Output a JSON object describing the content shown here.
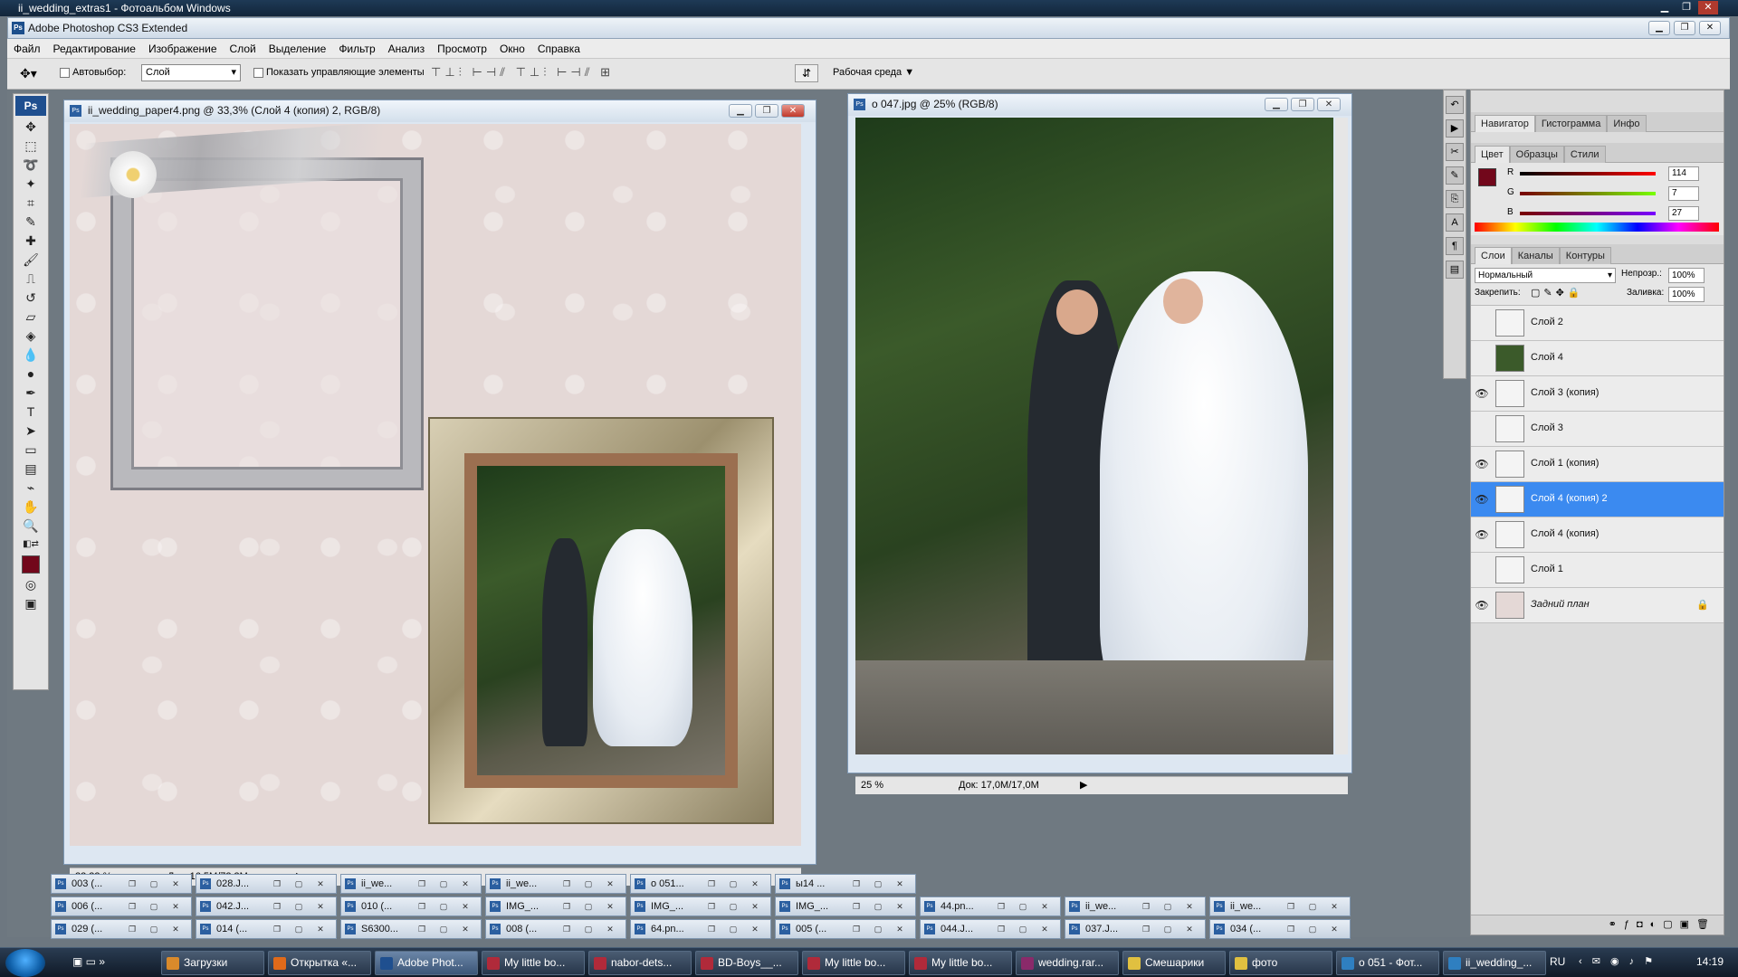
{
  "window": {
    "outer_title": "ii_wedding_extras1 - Фотоальбом Windows",
    "ps_title": "Adobe Photoshop CS3 Extended",
    "ps_badge": "Ps"
  },
  "menu": [
    "Файл",
    "Редактирование",
    "Изображение",
    "Слой",
    "Выделение",
    "Фильтр",
    "Анализ",
    "Просмотр",
    "Окно",
    "Справка"
  ],
  "options": {
    "autoselect_label": "Автовыбор:",
    "autoselect_value": "Слой",
    "show_controls_label": "Показать управляющие элементы",
    "workspace_label": "Рабочая среда"
  },
  "doc1": {
    "title": "ii_wedding_paper4.png @ 33,3% (Слой 4 (копия) 2, RGB/8)",
    "zoom": "33,33 %",
    "docsize": "Док: 16,5М/72,3М"
  },
  "doc2": {
    "title": "o 047.jpg @ 25% (RGB/8)",
    "zoom": "25 %",
    "docsize": "Док: 17,0М/17,0М"
  },
  "panels": {
    "nav_tabs": [
      "Навигатор",
      "Гистограмма",
      "Инфо"
    ],
    "color_tabs": [
      "Цвет",
      "Образцы",
      "Стили"
    ],
    "rgb": [
      {
        "label": "R",
        "value": "114"
      },
      {
        "label": "G",
        "value": "7"
      },
      {
        "label": "B",
        "value": "27"
      }
    ],
    "foreground_color": "#72071b",
    "layer_tabs": [
      "Слои",
      "Каналы",
      "Контуры"
    ],
    "blend_mode": "Нормальный",
    "opacity_label": "Непрозр.:",
    "opacity": "100%",
    "lock_label": "Закрепить:",
    "fill_label": "Заливка:",
    "fill": "100%",
    "layers": [
      {
        "name": "Слой 2",
        "visible": false
      },
      {
        "name": "Слой 4",
        "visible": false
      },
      {
        "name": "Слой 3 (копия)",
        "visible": true
      },
      {
        "name": "Слой 3",
        "visible": false
      },
      {
        "name": "Слой 1 (копия)",
        "visible": true
      },
      {
        "name": "Слой 4 (копия) 2",
        "visible": true
      },
      {
        "name": "Слой 4 (копия)",
        "visible": true
      },
      {
        "name": "Слой 1",
        "visible": false
      },
      {
        "name": "Задний план",
        "visible": true
      }
    ]
  },
  "minimized": [
    [
      "003 (...",
      "028.J...",
      "ii_we...",
      "ii_we...",
      "о 051...",
      "ы14 ..."
    ],
    [
      "006 (...",
      "042.J...",
      "010 (...",
      "IMG_...",
      "IMG_...",
      "IMG_...",
      "44.pn...",
      "ii_we...",
      "ii_we..."
    ],
    [
      "029 (...",
      "014 (...",
      "S6300...",
      "008 (...",
      "64.pn...",
      "005 (...",
      "044.J...",
      "037.J...",
      "034 (..."
    ]
  ],
  "taskbar": {
    "items": [
      "Загрузки",
      "Открытка «...",
      "Adobe Phot...",
      "My little bo...",
      "nabor-dets...",
      "BD-Boys__...",
      "My little bo...",
      "My little bo...",
      "wedding.rar...",
      "Смешарики",
      "фото",
      "о 051 - Фот...",
      "ii_wedding_..."
    ],
    "lang": "RU",
    "time": "14:19"
  }
}
